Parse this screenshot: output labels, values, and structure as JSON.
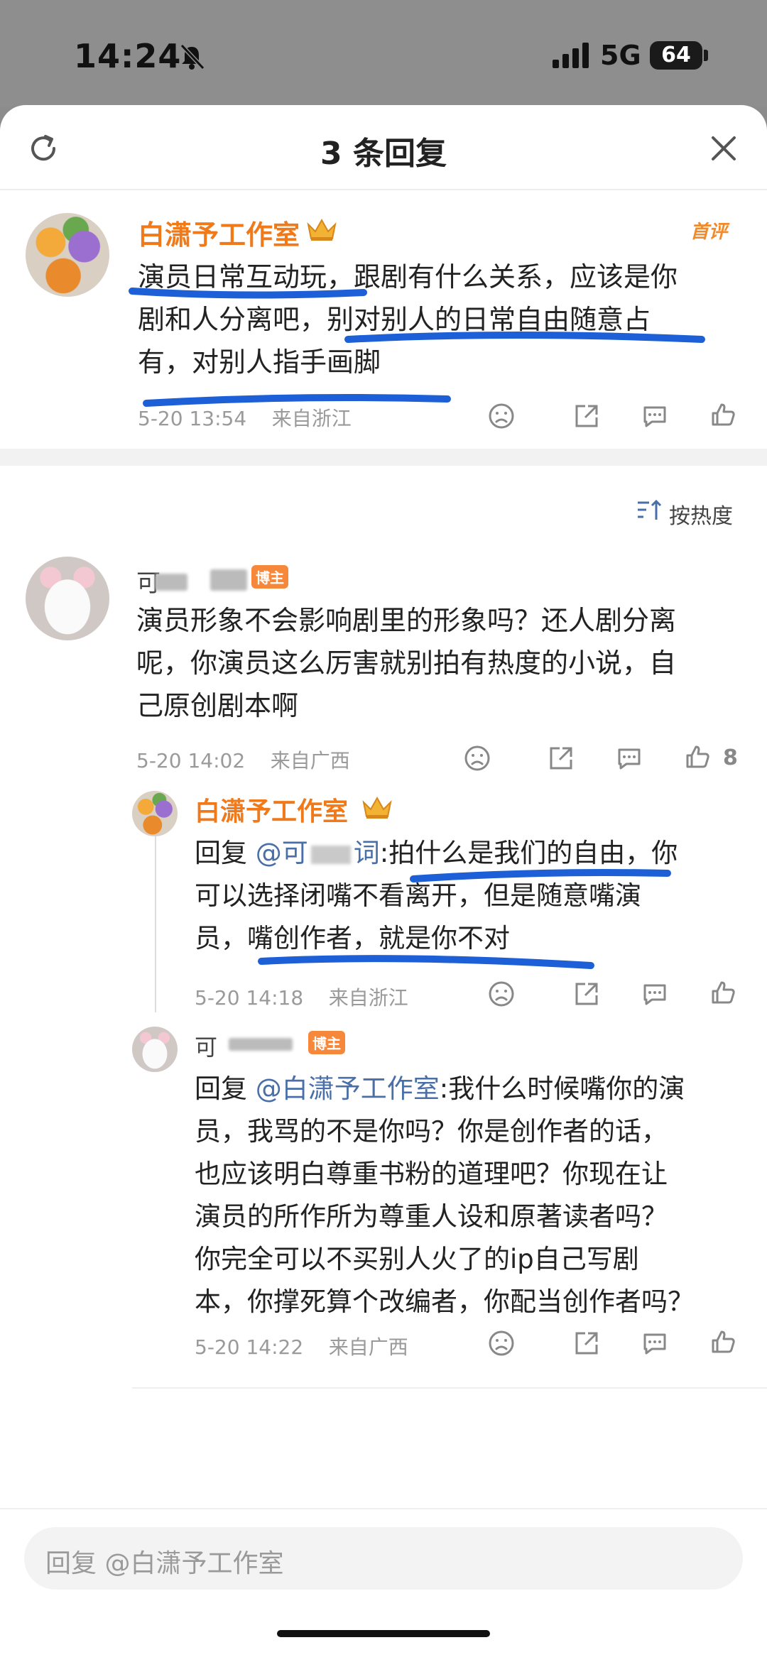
{
  "status_bar": {
    "time": "14:24",
    "network": "5G",
    "battery": "64"
  },
  "header": {
    "title": "3 条回复"
  },
  "main_comment": {
    "author": "白潇予工作室",
    "badge": "首评",
    "lines": [
      "演员日常互动玩，跟剧有什么关系，应该是你",
      "剧和人分离吧，别对别人的日常自由随意占",
      "有，对别人指手画脚"
    ],
    "time": "5-20 13:54",
    "location": "来自浙江"
  },
  "sort_label": "按热度",
  "reply1": {
    "author": "可",
    "tag": "博主",
    "lines": [
      "演员形象不会影响剧里的形象吗？还人剧分离",
      "呢，你演员这么厉害就别拍有热度的小说，自",
      "己原创剧本啊"
    ],
    "time": "5-20 14:02",
    "location": "来自广西",
    "likes": "8"
  },
  "reply2": {
    "author": "白潇予工作室",
    "line1_prefix": "回复",
    "line1_mention": "@可",
    "line1_mention_tail": "词",
    "line1_rest": ":拍什么是我们的自由，你",
    "line2": "可以选择闭嘴不看离开，但是随意嘴演",
    "line3": "员，嘴创作者，就是你不对",
    "time": "5-20 14:18",
    "location": "来自浙江"
  },
  "reply3": {
    "author": "可",
    "tag": "博主",
    "line1_prefix": "回复",
    "line1_mention": "@白潇予工作室",
    "line1_rest": ":我什么时候嘴你的演",
    "lines": [
      "员，我骂的不是你吗？你是创作者的话，",
      "也应该明白尊重书粉的道理吧？你现在让",
      "演员的所作所为尊重人设和原著读者吗？",
      "你完全可以不买别人火了的ip自己写剧",
      "本，你撑死算个改编者，你配当创作者吗？"
    ],
    "time": "5-20 14:22",
    "location": "来自广西"
  },
  "input": {
    "placeholder": "回复 @白潇予工作室"
  },
  "colors": {
    "name": "#f07a1a",
    "link": "#4a6fa8",
    "marker": "#1d5fd6",
    "meta": "#9a9a9a"
  },
  "icons": [
    "refresh-icon",
    "close-icon",
    "crown-icon",
    "dislike-icon",
    "share-icon",
    "comment-icon",
    "like-icon",
    "sort-icon",
    "bell-slash-icon",
    "signal-icon"
  ]
}
